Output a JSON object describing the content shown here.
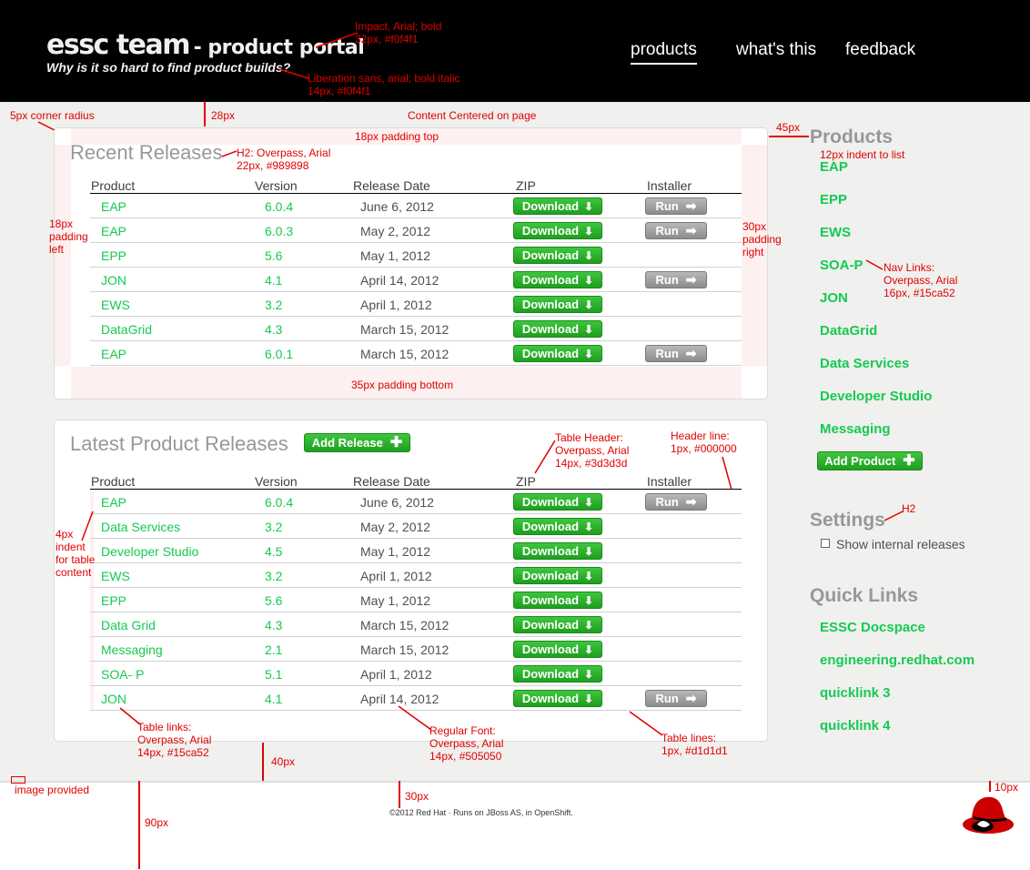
{
  "header": {
    "title_main": "essc team",
    "title_sub": "- product portal",
    "tagline": "Why is it so hard to find product builds?",
    "nav": [
      "products",
      "what's this",
      "feedback"
    ]
  },
  "annotations": {
    "impact": [
      "Impact, Arial; bold",
      "32px, #f0f4f1"
    ],
    "liberation": [
      "Liberation sans, arial; bold italic",
      "14px, #f0f4f1"
    ],
    "corner": "5px corner radius",
    "px28": "28px",
    "centered": "Content Centered on page",
    "pad_top": "18px padding top",
    "px45": "45px",
    "h2": [
      "H2: Overpass, Arial",
      "22px, #989898"
    ],
    "indent_list": "12px indent to list",
    "pad_left": [
      "18px",
      "padding",
      "left"
    ],
    "pad_right": [
      "30px",
      "padding",
      "right"
    ],
    "navlinks": [
      "Nav Links:",
      "Overpass, Arial",
      "16px, #15ca52"
    ],
    "pad_bottom": "35px padding bottom",
    "table_header": [
      "Table Header:",
      "Overpass, Arial",
      "14px, #3d3d3d"
    ],
    "header_line": [
      "Header line:",
      "1px, #000000"
    ],
    "indent_table": [
      "4px",
      "indent",
      "for table",
      "content"
    ],
    "h2_short": "H2",
    "table_links": [
      "Table links:",
      "Overpass, Arial",
      "14px, #15ca52"
    ],
    "regular_font": [
      "Regular Font:",
      "Overpass, Arial",
      "14px, #505050"
    ],
    "table_lines": [
      "Table lines:",
      "1px, #d1d1d1"
    ],
    "px40": "40px",
    "image_provided": "image provided",
    "px30": "30px",
    "px90": "90px",
    "px10": "10px"
  },
  "recent": {
    "title": "Recent Releases",
    "columns": [
      "Product",
      "Version",
      "Release Date",
      "ZIP",
      "Installer"
    ],
    "download_label": "Download",
    "run_label": "Run",
    "rows": [
      {
        "product": "EAP",
        "version": "6.0.4",
        "date": "June 6, 2012",
        "run": true
      },
      {
        "product": "EAP",
        "version": "6.0.3",
        "date": "May 2, 2012",
        "run": true
      },
      {
        "product": "EPP",
        "version": "5.6",
        "date": "May 1, 2012",
        "run": false
      },
      {
        "product": "JON",
        "version": "4.1",
        "date": "April 14, 2012",
        "run": true
      },
      {
        "product": "EWS",
        "version": "3.2",
        "date": "April 1, 2012",
        "run": false
      },
      {
        "product": "DataGrid",
        "version": "4.3",
        "date": "March 15, 2012",
        "run": false
      },
      {
        "product": "EAP",
        "version": "6.0.1",
        "date": "March 15, 2012",
        "run": true
      }
    ]
  },
  "latest": {
    "title": "Latest Product Releases",
    "add_release": "Add Release",
    "columns": [
      "Product",
      "Version",
      "Release Date",
      "ZIP",
      "Installer"
    ],
    "rows": [
      {
        "product": "EAP",
        "version": "6.0.4",
        "date": "June 6, 2012",
        "run": true
      },
      {
        "product": "Data Services",
        "version": "3.2",
        "date": "May 2, 2012",
        "run": false
      },
      {
        "product": "Developer Studio",
        "version": "4.5",
        "date": "May 1, 2012",
        "run": false
      },
      {
        "product": "EWS",
        "version": "3.2",
        "date": "April 1, 2012",
        "run": false
      },
      {
        "product": "EPP",
        "version": "5.6",
        "date": "May 1, 2012",
        "run": false
      },
      {
        "product": "Data Grid",
        "version": "4.3",
        "date": "March 15, 2012",
        "run": false
      },
      {
        "product": "Messaging",
        "version": "2.1",
        "date": "March 15, 2012",
        "run": false
      },
      {
        "product": "SOA- P",
        "version": "5.1",
        "date": "April 1, 2012",
        "run": false
      },
      {
        "product": "JON",
        "version": "4.1",
        "date": "April 14, 2012",
        "run": true
      }
    ]
  },
  "sidebar": {
    "products_title": "Products",
    "products": [
      "EAP",
      "EPP",
      "EWS",
      "SOA-P",
      "JON",
      "DataGrid",
      "Data Services",
      "Developer Studio",
      "Messaging"
    ],
    "add_product": "Add Product",
    "settings_title": "Settings",
    "show_internal": "Show internal releases",
    "quick_title": "Quick Links",
    "quick_links": [
      "ESSC Docspace",
      "engineering.redhat.com",
      "quicklink 3",
      "quicklink 4"
    ]
  },
  "footer": {
    "copyright": "©2012 Red Hat · Runs on JBoss AS, in OpenShift."
  },
  "colors": {
    "link": "#15ca52",
    "annotation": "#e00000",
    "header_bg": "#000000"
  }
}
